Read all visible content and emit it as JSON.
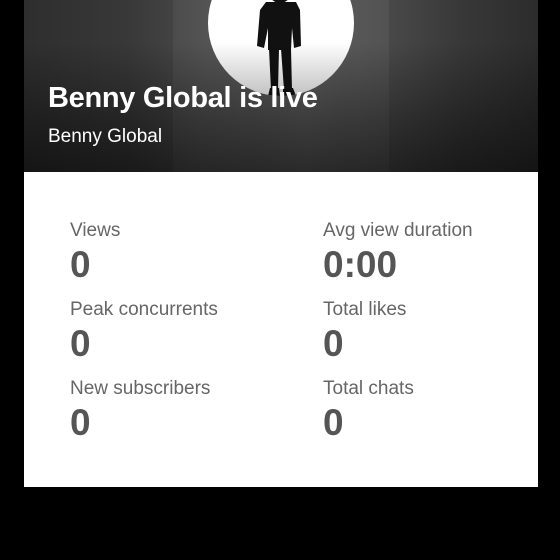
{
  "stream": {
    "title": "Benny Global is live",
    "channel": "Benny Global"
  },
  "stats": {
    "views": {
      "label": "Views",
      "value": "0"
    },
    "avg_view_duration": {
      "label": "Avg view duration",
      "value": "0:00"
    },
    "peak_concurrents": {
      "label": "Peak concurrents",
      "value": "0"
    },
    "total_likes": {
      "label": "Total likes",
      "value": "0"
    },
    "new_subscribers": {
      "label": "New subscribers",
      "value": "0"
    },
    "total_chats": {
      "label": "Total chats",
      "value": "0"
    }
  },
  "colors": {
    "background": "#000000",
    "card": "#ffffff",
    "label_text": "#666666",
    "value_text": "#555555",
    "hero_text": "#ffffff"
  },
  "icons": {
    "avatar": "person-silhouette-avatar"
  }
}
